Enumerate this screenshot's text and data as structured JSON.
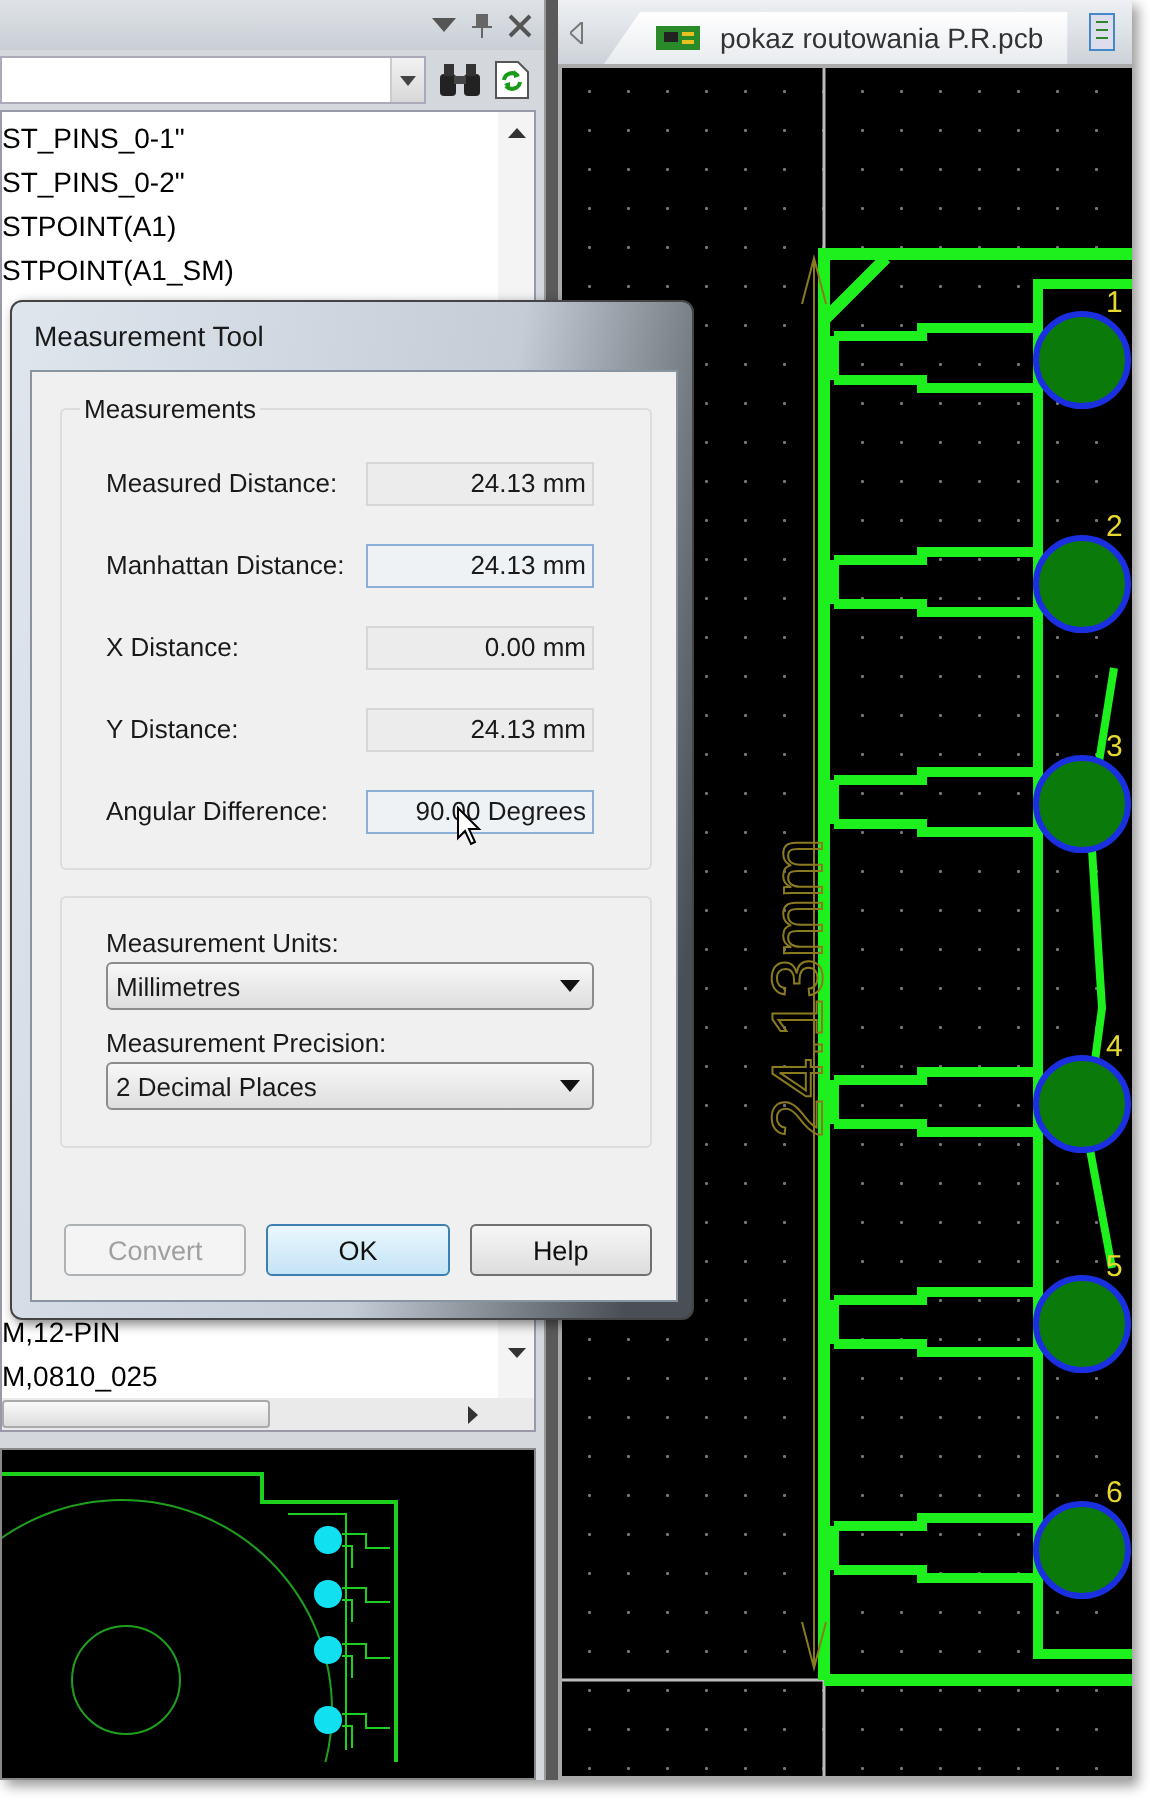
{
  "library_panel": {
    "list": {
      "items_above": [
        "ST_PINS_0-1\"",
        "ST_PINS_0-2\"",
        "STPOINT(A1)",
        "STPOINT(A1_SM)"
      ],
      "items_below": [
        "M,12-PIN",
        "M,0810_025"
      ]
    }
  },
  "document": {
    "tabs": [
      {
        "label": "pokaz routowania P.R.pcb",
        "selected": true
      }
    ],
    "dimension_label": "24.13mm",
    "pad_numbers": [
      "1",
      "2",
      "3",
      "4",
      "5",
      "6"
    ]
  },
  "dialog": {
    "title": "Measurement Tool",
    "group_title": "Measurements",
    "fields": [
      {
        "label": "Measured Distance:",
        "value": "24.13 mm",
        "highlighted": false
      },
      {
        "label": "Manhattan Distance:",
        "value": "24.13 mm",
        "highlighted": true
      },
      {
        "label": "X Distance:",
        "value": "0.00 mm",
        "highlighted": false
      },
      {
        "label": "Y Distance:",
        "value": "24.13 mm",
        "highlighted": false
      },
      {
        "label": "Angular Difference:",
        "value": "90.00 Degrees",
        "highlighted": true
      }
    ],
    "dropdowns": [
      {
        "label": "Measurement Units:",
        "value": "Millimetres"
      },
      {
        "label": "Measurement Precision:",
        "value": "2 Decimal Places"
      }
    ],
    "buttons": [
      {
        "label": "Convert",
        "disabled": true,
        "default": false
      },
      {
        "label": "OK",
        "disabled": false,
        "default": true
      },
      {
        "label": "Help",
        "disabled": false,
        "default": false
      }
    ]
  }
}
